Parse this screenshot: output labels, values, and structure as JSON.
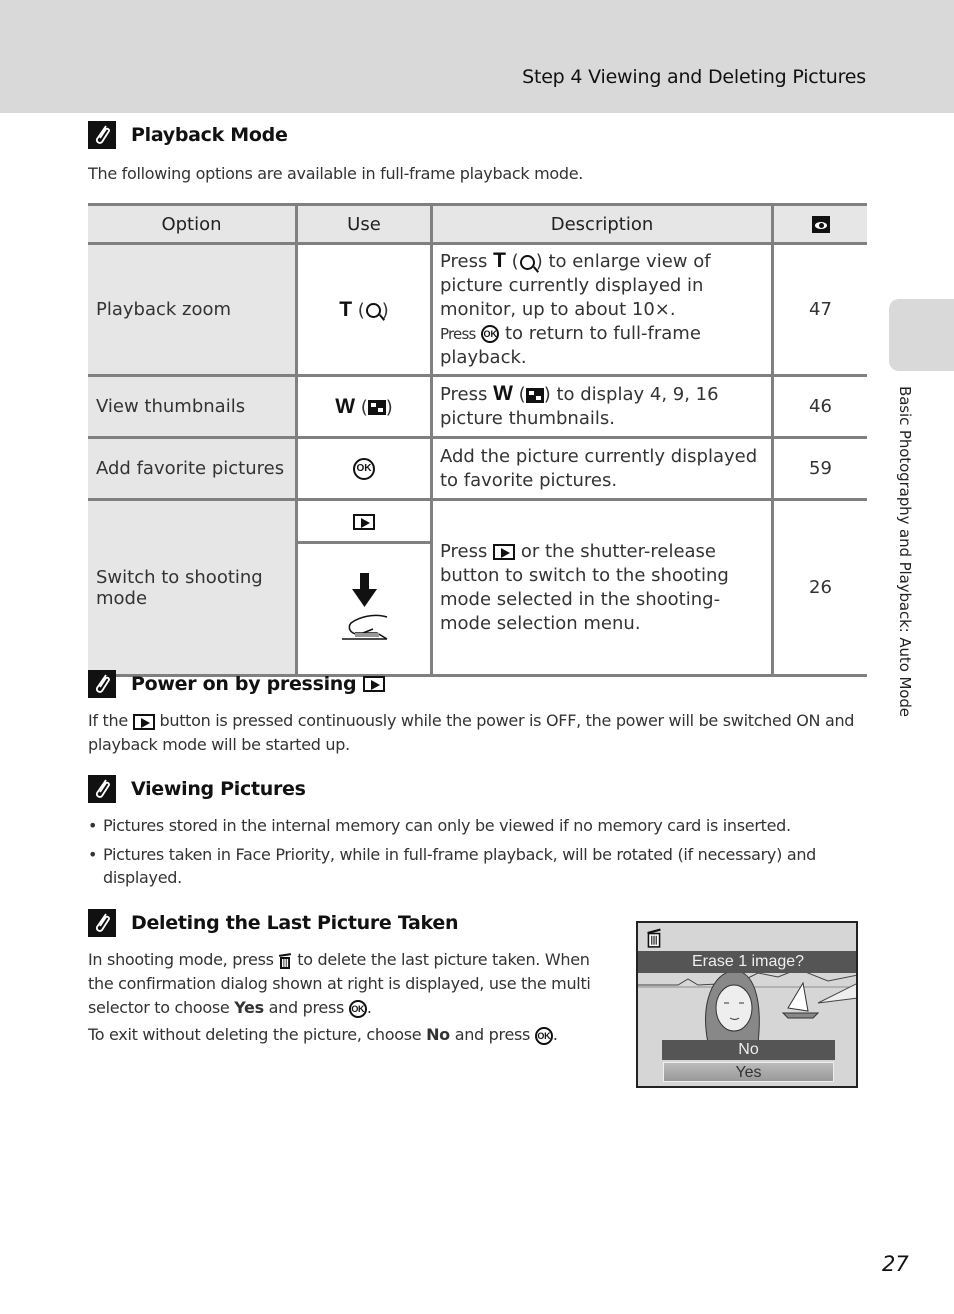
{
  "header": {
    "title": "Step 4 Viewing and Deleting Pictures"
  },
  "side_tab": {
    "label": "Basic Photography and Playback: Auto Mode"
  },
  "page_number": "27",
  "playback_mode": {
    "title": "Playback Mode",
    "intro": "The following options are available in full-frame playback mode.",
    "table": {
      "headers": [
        "Option",
        "Use",
        "Description",
        "page-ref-icon"
      ],
      "rows": [
        {
          "option": "Playback zoom",
          "use_key": "T",
          "use_icon": "magnifier-icon",
          "desc_pre": "Press",
          "desc_key": "T",
          "desc_mid": "to enlarge view of picture currently displayed in monitor, up to about 10×.",
          "desc_press": "Press",
          "desc_end": "to return to full-frame playback.",
          "ref": "47"
        },
        {
          "option": "View thumbnails",
          "use_key": "W",
          "use_icon": "thumbnail-icon",
          "desc_pre": "Press",
          "desc_key": "W",
          "desc_mid": "to display 4, 9, 16 picture thumbnails.",
          "ref": "46"
        },
        {
          "option": "Add favorite pictures",
          "use_icon": "ok-button-icon",
          "desc": "Add the picture currently displayed to favorite pictures.",
          "ref": "59"
        },
        {
          "option": "Switch to shooting mode",
          "use_icon": "playback-button-icon",
          "use_icon_2": "shutter-release-icon",
          "desc_pre": "Press",
          "desc_mid": "or the shutter-release button to switch to the shooting mode selected in the shooting-mode selection menu.",
          "ref": "26"
        }
      ]
    }
  },
  "power_on": {
    "title": "Power on by pressing",
    "text_pre": "If the",
    "text_post": "button is pressed continuously while the power is OFF, the power will be switched ON and playback mode will be started up."
  },
  "viewing": {
    "title": "Viewing Pictures",
    "bullets": [
      "Pictures stored in the internal memory can only be viewed if no memory card is inserted.",
      "Pictures taken in Face Priority, while in full-frame playback, will be rotated (if necessary) and displayed."
    ]
  },
  "deleting": {
    "title": "Deleting the Last Picture Taken",
    "p1_a": "In shooting mode, press",
    "p1_b": "to delete the last picture taken. When the confirmation dialog shown at right is displayed, use the multi selector to choose",
    "p1_yes": "Yes",
    "p1_c": "and press",
    "p2_a": "To exit without deleting the picture, choose",
    "p2_no": "No",
    "p2_b": "and press",
    "ok_label": "OK"
  },
  "camera_screen": {
    "prompt": "Erase 1 image?",
    "options": [
      "No",
      "Yes"
    ],
    "selected": "Yes"
  }
}
